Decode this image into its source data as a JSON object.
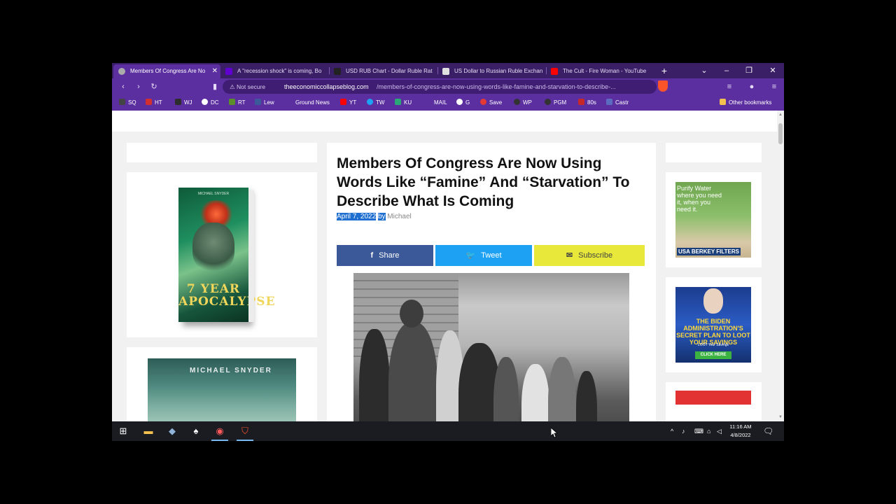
{
  "tabs": [
    {
      "label": "Members Of Congress Are No",
      "active": true,
      "icon": "globe-icon"
    },
    {
      "label": "A \"recession shock\" is coming, Bo",
      "active": false,
      "icon": "yahoo-icon"
    },
    {
      "label": "USD RUB Chart - Dollar Ruble Rat",
      "active": false,
      "icon": "tradingview-icon"
    },
    {
      "label": "US Dollar to Russian Ruble Exchan",
      "active": false,
      "icon": "exchange-icon"
    },
    {
      "label": "The Cult - Fire Woman - YouTube",
      "active": false,
      "icon": "youtube-icon"
    }
  ],
  "address": {
    "security": "Not secure",
    "host": "theeconomiccollapseblog.com",
    "path": "/members-of-congress-are-now-using-words-like-famine-and-starvation-to-describe-..."
  },
  "bookmarks": [
    {
      "label": "SQ",
      "color": "#444444"
    },
    {
      "label": "HT",
      "color": "#d32f2f"
    },
    {
      "label": "WJ",
      "color": "#2d2d2d"
    },
    {
      "label": "DC",
      "color": "#ffffff"
    },
    {
      "label": "RT",
      "color": "#5a8f29"
    },
    {
      "label": "Lew",
      "color": "#3c5a99"
    },
    {
      "label": "Ground News",
      "color": "#5b2fa0"
    },
    {
      "label": "YT",
      "color": "#ff0000"
    },
    {
      "label": "TW",
      "color": "#1da1f2"
    },
    {
      "label": "KU",
      "color": "#2aa876"
    },
    {
      "label": "MAIL",
      "color": "#5b2fa0"
    },
    {
      "label": "G",
      "color": "#ffffff"
    },
    {
      "label": "Save",
      "color": "#e53935"
    },
    {
      "label": "WP",
      "color": "#333333"
    },
    {
      "label": "PGM",
      "color": "#333333"
    },
    {
      "label": "80s",
      "color": "#c62828"
    },
    {
      "label": "Castr",
      "color": "#5c6bc0"
    }
  ],
  "other_bookmarks": "Other bookmarks",
  "article": {
    "title": "Members Of Congress Are Now Using Words Like “Famine” And “Starvation” To Describe What Is Coming",
    "date": "April 7, 2022",
    "by": "by",
    "author": "Michael"
  },
  "share": {
    "facebook": "Share",
    "twitter": "Tweet",
    "subscribe": "Subscribe",
    "facebook_color": "#3b5998",
    "twitter_color": "#1da1f2",
    "subscribe_color": "#e8e83a"
  },
  "sidebar_left": {
    "book_title": "7 YEAR APOCALYPSE",
    "book_author": "MICHAEL SNYDER",
    "book2_text": "MICHAEL SNYDER"
  },
  "ads": {
    "water_text": "Purify Water where you need it, when you need it.",
    "water_brand": "USA BERKEY FILTERS",
    "biden_text": "THE BIDEN ADMINISTRATION'S SECRET PLAN TO LOOT YOUR SAVINGS",
    "biden_sub": "LOOT Your Savings",
    "biden_btn": "CLICK HERE"
  },
  "taskbar": {
    "time": "11:16 AM",
    "date": "4/8/2022"
  }
}
